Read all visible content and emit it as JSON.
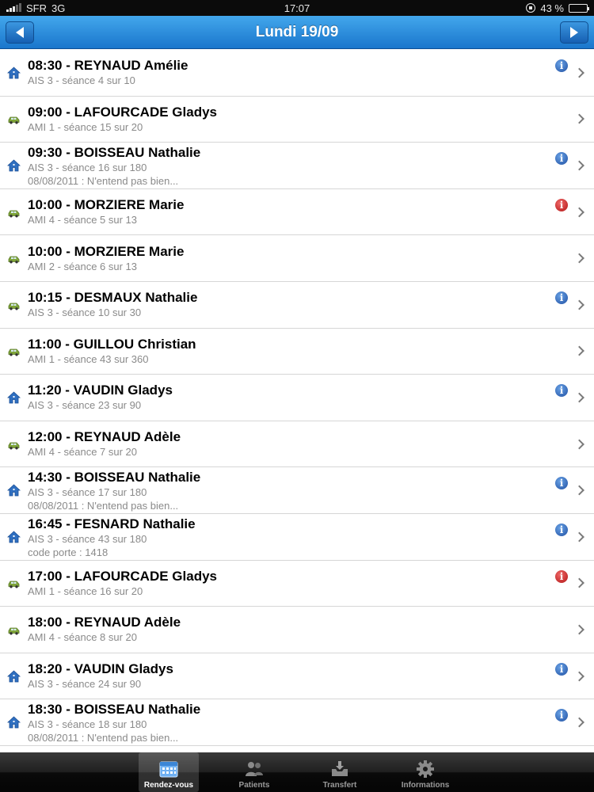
{
  "status_bar": {
    "carrier": "SFR",
    "network": "3G",
    "time": "17:07",
    "battery": "43 %",
    "battery_level": 0.43
  },
  "nav": {
    "title": "Lundi 19/09"
  },
  "appointments": [
    {
      "icon": "house-icon",
      "title": "08:30 - REYNAUD Amélie",
      "subtitle": "AIS 3 - séance 4 sur 10",
      "note": "",
      "info": "blue"
    },
    {
      "icon": "car-icon",
      "title": "09:00 - LAFOURCADE Gladys",
      "subtitle": "AMI 1 - séance 15 sur 20",
      "note": "",
      "info": ""
    },
    {
      "icon": "house-icon",
      "title": "09:30 - BOISSEAU Nathalie",
      "subtitle": "AIS 3 - séance 16 sur 180",
      "note": "08/08/2011 : N'entend pas bien...",
      "info": "blue"
    },
    {
      "icon": "car-icon",
      "title": "10:00 - MORZIERE Marie",
      "subtitle": "AMI 4 - séance 5 sur 13",
      "note": "",
      "info": "red"
    },
    {
      "icon": "car-icon",
      "title": "10:00 - MORZIERE Marie",
      "subtitle": "AMI 2 - séance 6 sur 13",
      "note": "",
      "info": ""
    },
    {
      "icon": "car-icon",
      "title": "10:15 - DESMAUX Nathalie",
      "subtitle": "AIS 3 - séance 10 sur 30",
      "note": "",
      "info": "blue"
    },
    {
      "icon": "car-icon",
      "title": "11:00 - GUILLOU Christian",
      "subtitle": "AMI 1 - séance 43 sur 360",
      "note": "",
      "info": ""
    },
    {
      "icon": "house-icon",
      "title": "11:20 - VAUDIN Gladys",
      "subtitle": "AIS 3 - séance 23 sur 90",
      "note": "",
      "info": "blue"
    },
    {
      "icon": "car-icon",
      "title": "12:00 - REYNAUD Adèle",
      "subtitle": "AMI 4 - séance 7 sur 20",
      "note": "",
      "info": ""
    },
    {
      "icon": "house-icon",
      "title": "14:30 - BOISSEAU Nathalie",
      "subtitle": "AIS 3 - séance 17 sur 180",
      "note": "08/08/2011 : N'entend pas bien...",
      "info": "blue"
    },
    {
      "icon": "house-icon",
      "title": "16:45 - FESNARD Nathalie",
      "subtitle": "AIS 3 - séance 43 sur 180",
      "note": "code porte : 1418",
      "info": "blue"
    },
    {
      "icon": "car-icon",
      "title": "17:00 - LAFOURCADE Gladys",
      "subtitle": "AMI 1 - séance 16 sur 20",
      "note": "",
      "info": "red"
    },
    {
      "icon": "car-icon",
      "title": "18:00 - REYNAUD Adèle",
      "subtitle": "AMI 4 - séance 8 sur 20",
      "note": "",
      "info": ""
    },
    {
      "icon": "house-icon",
      "title": "18:20 - VAUDIN Gladys",
      "subtitle": "AIS 3 - séance 24 sur 90",
      "note": "",
      "info": "blue"
    },
    {
      "icon": "house-icon",
      "title": "18:30 - BOISSEAU Nathalie",
      "subtitle": "AIS 3 - séance 18 sur 180",
      "note": "08/08/2011 : N'entend pas bien...",
      "info": "blue"
    }
  ],
  "tabs": [
    {
      "label": "Rendez-vous",
      "icon": "calendar-icon",
      "active": true
    },
    {
      "label": "Patients",
      "icon": "people-icon",
      "active": false
    },
    {
      "label": "Transfert",
      "icon": "inbox-icon",
      "active": false
    },
    {
      "label": "Informations",
      "icon": "gear-icon",
      "active": false
    }
  ],
  "colors": {
    "nav_top": "#43a7ec",
    "nav_bottom": "#1a76cc",
    "info_blue": "#1f4fa2",
    "info_red": "#b21414",
    "house_blue": "#2f6fc0",
    "car_green": "#7fa43a"
  }
}
